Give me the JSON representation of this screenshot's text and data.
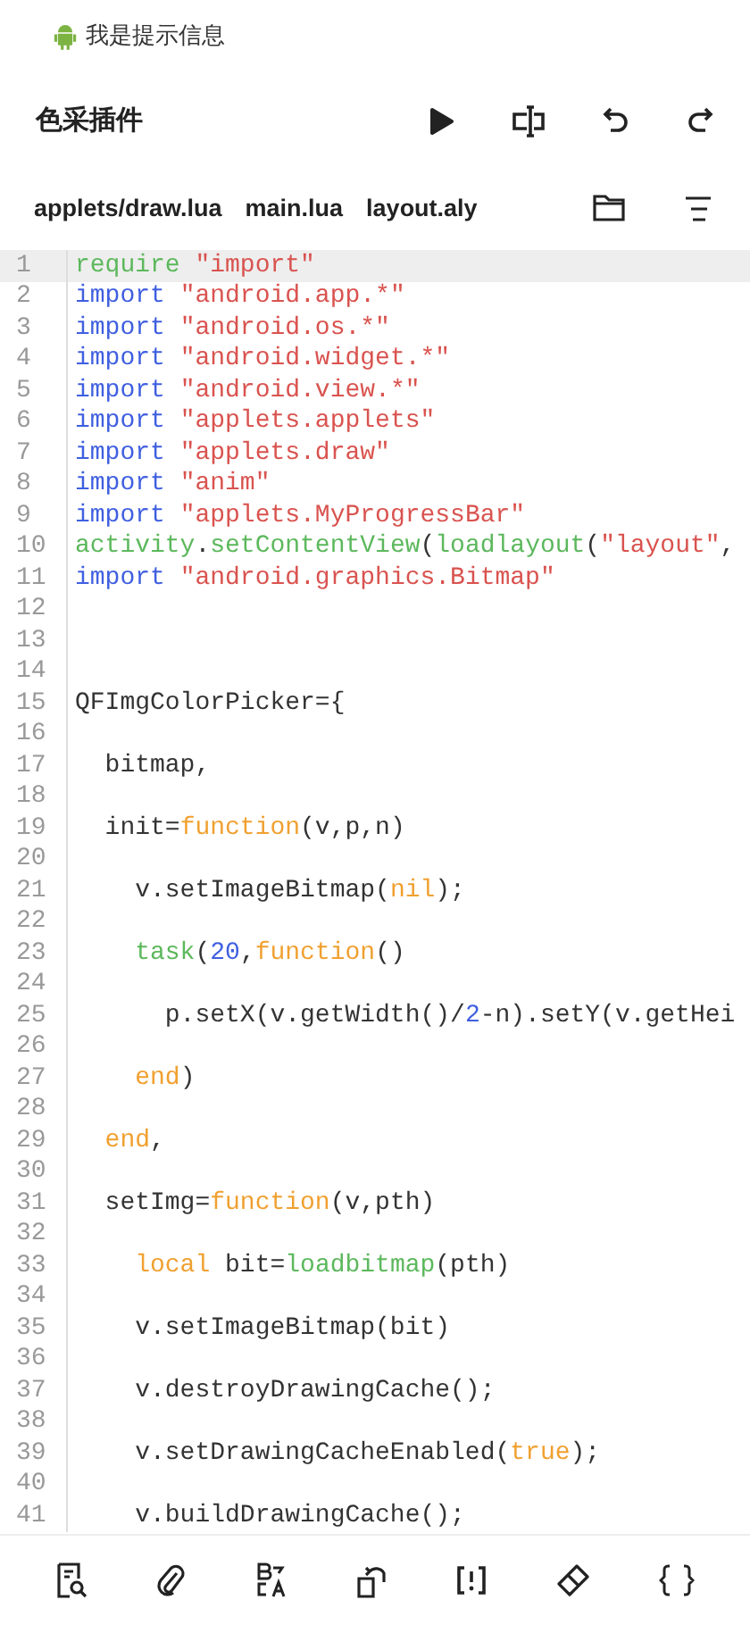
{
  "status_bar": {
    "message": "我是提示信息"
  },
  "toolbar": {
    "title": "色采插件",
    "actions": [
      {
        "kind": "run"
      },
      {
        "kind": "text-cursor"
      },
      {
        "kind": "undo"
      },
      {
        "kind": "redo"
      }
    ]
  },
  "file_tabs": [
    "applets/draw.lua",
    "main.lua",
    "layout.aly"
  ],
  "tab_actions": [
    {
      "kind": "folder"
    },
    {
      "kind": "menu"
    }
  ],
  "editor": {
    "lines": [
      {
        "number": "1",
        "current": true,
        "tokens": [
          {
            "t": "require",
            "kind": "builtin"
          },
          {
            "t": " \"import\"",
            "kind": "string"
          }
        ]
      },
      {
        "number": "2",
        "current": false,
        "tokens": [
          {
            "t": "import",
            "kind": "keyword"
          },
          {
            "t": " \"android.app.*\"",
            "kind": "string"
          }
        ]
      },
      {
        "number": "3",
        "current": false,
        "tokens": [
          {
            "t": "import",
            "kind": "keyword"
          },
          {
            "t": " \"android.os.*\"",
            "kind": "string"
          }
        ]
      },
      {
        "number": "4",
        "current": false,
        "tokens": [
          {
            "t": "import",
            "kind": "keyword"
          },
          {
            "t": " \"android.widget.*\"",
            "kind": "string"
          }
        ]
      },
      {
        "number": "5",
        "current": false,
        "tokens": [
          {
            "t": "import",
            "kind": "keyword"
          },
          {
            "t": " \"android.view.*\"",
            "kind": "string"
          }
        ]
      },
      {
        "number": "6",
        "current": false,
        "tokens": [
          {
            "t": "import",
            "kind": "keyword"
          },
          {
            "t": " \"applets.applets\"",
            "kind": "string"
          }
        ]
      },
      {
        "number": "7",
        "current": false,
        "tokens": [
          {
            "t": "import",
            "kind": "keyword"
          },
          {
            "t": " \"applets.draw\"",
            "kind": "string"
          }
        ]
      },
      {
        "number": "8",
        "current": false,
        "tokens": [
          {
            "t": "import",
            "kind": "keyword"
          },
          {
            "t": " \"anim\"",
            "kind": "string"
          }
        ]
      },
      {
        "number": "9",
        "current": false,
        "tokens": [
          {
            "t": "import",
            "kind": "keyword"
          },
          {
            "t": " \"applets.MyProgressBar\"",
            "kind": "string"
          }
        ]
      },
      {
        "number": "10",
        "current": false,
        "tokens": [
          {
            "t": "activity",
            "kind": "builtin"
          },
          {
            "t": ".",
            "kind": "plain"
          },
          {
            "t": "setContentView",
            "kind": "builtin"
          },
          {
            "t": "(",
            "kind": "plain"
          },
          {
            "t": "loadlayout",
            "kind": "builtin"
          },
          {
            "t": "(",
            "kind": "plain"
          },
          {
            "t": "\"layout\"",
            "kind": "string"
          },
          {
            "t": ",",
            "kind": "plain"
          }
        ]
      },
      {
        "number": "11",
        "current": false,
        "tokens": [
          {
            "t": "import",
            "kind": "keyword"
          },
          {
            "t": " \"android.graphics.Bitmap\"",
            "kind": "string"
          }
        ]
      },
      {
        "number": "12",
        "current": false
      },
      {
        "number": "13",
        "current": false
      },
      {
        "number": "14",
        "current": false
      },
      {
        "number": "15",
        "current": false,
        "tokens": [
          {
            "t": "QFImgColorPicker={",
            "kind": "plain"
          }
        ]
      },
      {
        "number": "16",
        "current": false
      },
      {
        "number": "17",
        "current": false,
        "tokens": [
          {
            "t": "  bitmap,",
            "kind": "plain"
          }
        ]
      },
      {
        "number": "18",
        "current": false
      },
      {
        "number": "19",
        "current": false,
        "tokens": [
          {
            "t": "  init=",
            "kind": "plain"
          },
          {
            "t": "function",
            "kind": "literal"
          },
          {
            "t": "(v,p,n)",
            "kind": "plain"
          }
        ]
      },
      {
        "number": "20",
        "current": false
      },
      {
        "number": "21",
        "current": false,
        "tokens": [
          {
            "t": "    v.setImageBitmap(",
            "kind": "plain"
          },
          {
            "t": "nil",
            "kind": "literal"
          },
          {
            "t": ");",
            "kind": "plain"
          }
        ]
      },
      {
        "number": "22",
        "current": false
      },
      {
        "number": "23",
        "current": false,
        "tokens": [
          {
            "t": "    task",
            "kind": "builtin"
          },
          {
            "t": "(",
            "kind": "plain"
          },
          {
            "t": "20",
            "kind": "number"
          },
          {
            "t": ",",
            "kind": "plain"
          },
          {
            "t": "function",
            "kind": "literal"
          },
          {
            "t": "()",
            "kind": "plain"
          }
        ]
      },
      {
        "number": "24",
        "current": false
      },
      {
        "number": "25",
        "current": false,
        "tokens": [
          {
            "t": "      p.setX(v.getWidth()/",
            "kind": "plain"
          },
          {
            "t": "2",
            "kind": "number"
          },
          {
            "t": "-n).setY(v.getHei",
            "kind": "plain"
          }
        ]
      },
      {
        "number": "26",
        "current": false
      },
      {
        "number": "27",
        "current": false,
        "tokens": [
          {
            "t": "    end",
            "kind": "literal"
          },
          {
            "t": ")",
            "kind": "plain"
          }
        ]
      },
      {
        "number": "28",
        "current": false
      },
      {
        "number": "29",
        "current": false,
        "tokens": [
          {
            "t": "  end",
            "kind": "literal"
          },
          {
            "t": ",",
            "kind": "plain"
          }
        ]
      },
      {
        "number": "30",
        "current": false
      },
      {
        "number": "31",
        "current": false,
        "tokens": [
          {
            "t": "  setImg=",
            "kind": "plain"
          },
          {
            "t": "function",
            "kind": "literal"
          },
          {
            "t": "(v,pth)",
            "kind": "plain"
          }
        ]
      },
      {
        "number": "32",
        "current": false
      },
      {
        "number": "33",
        "current": false,
        "tokens": [
          {
            "t": "    local",
            "kind": "literal"
          },
          {
            "t": " bit=",
            "kind": "plain"
          },
          {
            "t": "loadbitmap",
            "kind": "builtin"
          },
          {
            "t": "(pth)",
            "kind": "plain"
          }
        ]
      },
      {
        "number": "34",
        "current": false
      },
      {
        "number": "35",
        "current": false,
        "tokens": [
          {
            "t": "    v.setImageBitmap(bit)",
            "kind": "plain"
          }
        ]
      },
      {
        "number": "36",
        "current": false
      },
      {
        "number": "37",
        "current": false,
        "tokens": [
          {
            "t": "    v.destroyDrawingCache();",
            "kind": "plain"
          }
        ]
      },
      {
        "number": "38",
        "current": false
      },
      {
        "number": "39",
        "current": false,
        "tokens": [
          {
            "t": "    v.setDrawingCacheEnabled(",
            "kind": "plain"
          },
          {
            "t": "true",
            "kind": "literal"
          },
          {
            "t": ");",
            "kind": "plain"
          }
        ]
      },
      {
        "number": "40",
        "current": false
      },
      {
        "number": "41",
        "current": false,
        "tokens": [
          {
            "t": "    v.buildDrawingCache();",
            "kind": "plain"
          }
        ]
      }
    ]
  },
  "bottom_bar": [
    {
      "kind": "search-document"
    },
    {
      "kind": "attachment"
    },
    {
      "kind": "translate"
    },
    {
      "kind": "rotate"
    },
    {
      "kind": "brackets-exclamation"
    },
    {
      "kind": "eraser"
    },
    {
      "kind": "braces"
    }
  ]
}
